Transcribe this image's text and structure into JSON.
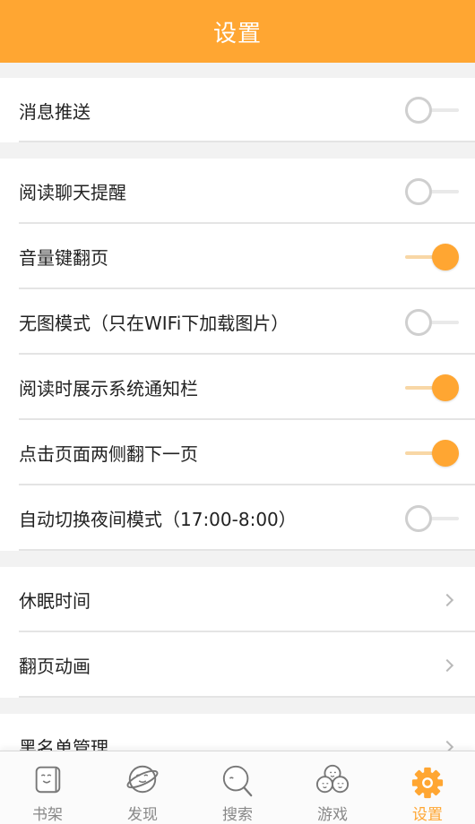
{
  "header": {
    "title": "设置"
  },
  "groups": [
    {
      "items": [
        {
          "label": "消息推送",
          "control": "toggle",
          "on": false
        }
      ]
    },
    {
      "items": [
        {
          "label": "阅读聊天提醒",
          "control": "toggle",
          "on": false
        },
        {
          "label": "音量键翻页",
          "control": "toggle",
          "on": true
        },
        {
          "label": "无图模式（只在WIFi下加载图片）",
          "control": "toggle",
          "on": false
        },
        {
          "label": "阅读时展示系统通知栏",
          "control": "toggle",
          "on": true
        },
        {
          "label": "点击页面两侧翻下一页",
          "control": "toggle",
          "on": true
        },
        {
          "label": "自动切换夜间模式（17:00-8:00）",
          "control": "toggle",
          "on": false
        }
      ]
    },
    {
      "items": [
        {
          "label": "休眠时间",
          "control": "chevron"
        },
        {
          "label": "翻页动画",
          "control": "chevron"
        }
      ]
    },
    {
      "items": [
        {
          "label": "黑名单管理",
          "control": "chevron"
        }
      ]
    }
  ],
  "tabs": [
    {
      "label": "书架",
      "icon": "bookshelf-icon",
      "active": false
    },
    {
      "label": "发现",
      "icon": "planet-icon",
      "active": false
    },
    {
      "label": "搜索",
      "icon": "search-icon",
      "active": false
    },
    {
      "label": "游戏",
      "icon": "game-icon",
      "active": false
    },
    {
      "label": "设置",
      "icon": "gear-icon",
      "active": true
    }
  ],
  "colors": {
    "accent": "#ffa632",
    "background": "#f2f2f2"
  }
}
